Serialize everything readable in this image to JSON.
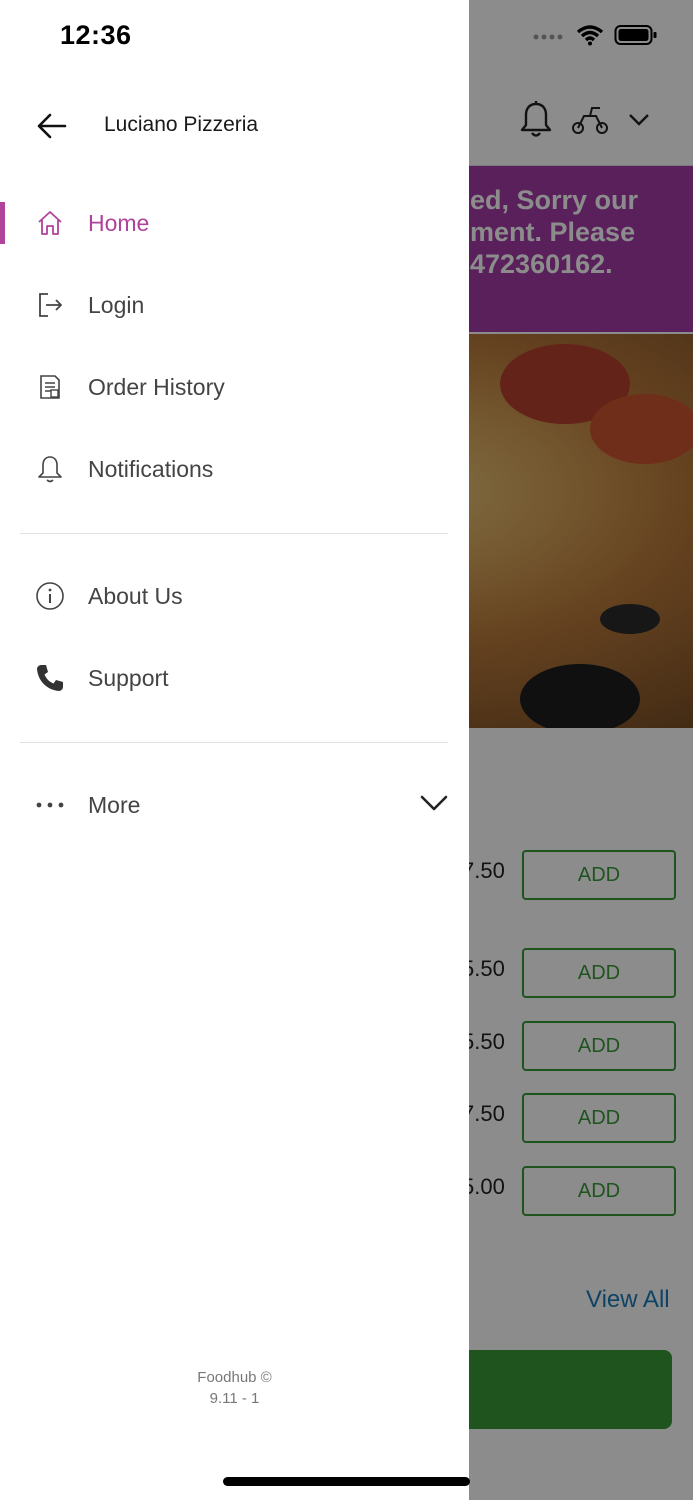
{
  "status_bar": {
    "time": "12:36"
  },
  "background": {
    "banner_lines": [
      "ed, Sorry our",
      "ment. Please",
      "472360162."
    ],
    "menu_rows": [
      {
        "price": "7.50",
        "add_label": "ADD"
      },
      {
        "price": "5.50",
        "add_label": "ADD"
      },
      {
        "price": "5.50",
        "add_label": "ADD"
      },
      {
        "price": "7.50",
        "add_label": "ADD"
      },
      {
        "price": "5.00",
        "add_label": "ADD"
      }
    ],
    "view_all_label": "View All"
  },
  "drawer": {
    "restaurant_name": "Luciano Pizzeria",
    "menu": [
      {
        "label": "Home",
        "icon": "home-icon",
        "active": true
      },
      {
        "label": "Login",
        "icon": "login-icon",
        "active": false
      },
      {
        "label": "Order History",
        "icon": "order-history-icon",
        "active": false
      },
      {
        "label": "Notifications",
        "icon": "bell-icon",
        "active": false
      }
    ],
    "secondary_menu": [
      {
        "label": "About Us",
        "icon": "info-icon"
      },
      {
        "label": "Support",
        "icon": "phone-icon"
      }
    ],
    "more": {
      "label": "More",
      "icon": "more-dots-icon"
    },
    "footer": {
      "brand": "Foodhub ©",
      "version": "9.11 - 1"
    }
  },
  "colors": {
    "accent": "#b0439a",
    "banner": "#a23ba7",
    "add_button": "#3a9a3a",
    "link": "#1a7ab8"
  }
}
